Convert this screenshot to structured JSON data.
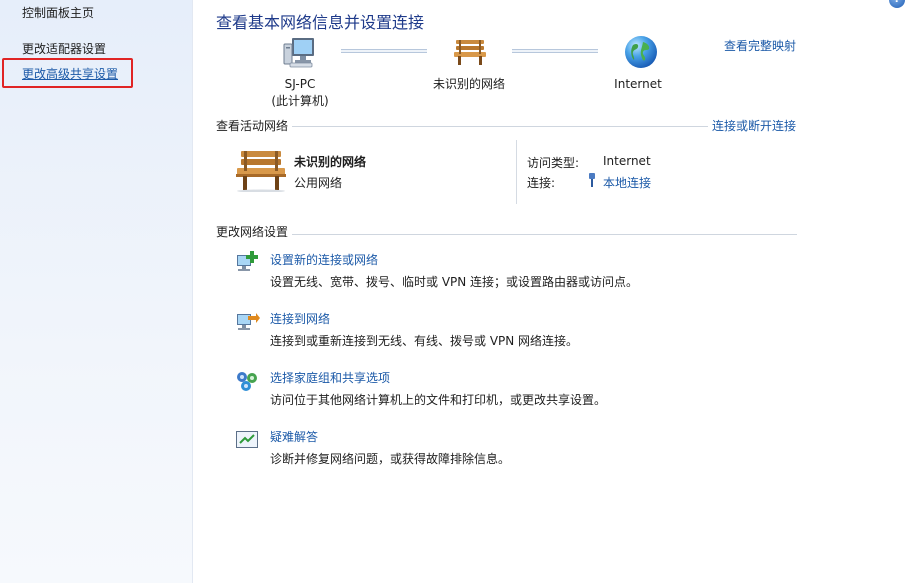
{
  "sidebar": {
    "home": "控制面板主页",
    "adapter": "更改适配器设置",
    "advanced": "更改高级共享设置"
  },
  "header": {
    "title": "查看基本网络信息并设置连接",
    "full_map": "查看完整映射"
  },
  "map": {
    "pc_name": "SJ-PC",
    "pc_sub": "(此计算机)",
    "network": "未识别的网络",
    "internet": "Internet"
  },
  "active": {
    "header": "查看活动网络",
    "toggle": "连接或断开连接",
    "network_name": "未识别的网络",
    "network_type": "公用网络",
    "access_label": "访问类型:",
    "access_value": "Internet",
    "conn_label": "连接:",
    "conn_value": "本地连接"
  },
  "settings": {
    "header": "更改网络设置",
    "tasks": [
      {
        "link": "设置新的连接或网络",
        "desc": "设置无线、宽带、拨号、临时或 VPN 连接；或设置路由器或访问点。",
        "icon": "new-connection-icon"
      },
      {
        "link": "连接到网络",
        "desc": "连接到或重新连接到无线、有线、拨号或 VPN 网络连接。",
        "icon": "connect-network-icon"
      },
      {
        "link": "选择家庭组和共享选项",
        "desc": "访问位于其他网络计算机上的文件和打印机，或更改共享设置。",
        "icon": "homegroup-icon"
      },
      {
        "link": "疑难解答",
        "desc": "诊断并修复网络问题，或获得故障排除信息。",
        "icon": "troubleshoot-icon"
      }
    ]
  },
  "colors": {
    "link": "#1c5aa8",
    "title": "#1e3a8a",
    "highlight": "#e02424"
  }
}
